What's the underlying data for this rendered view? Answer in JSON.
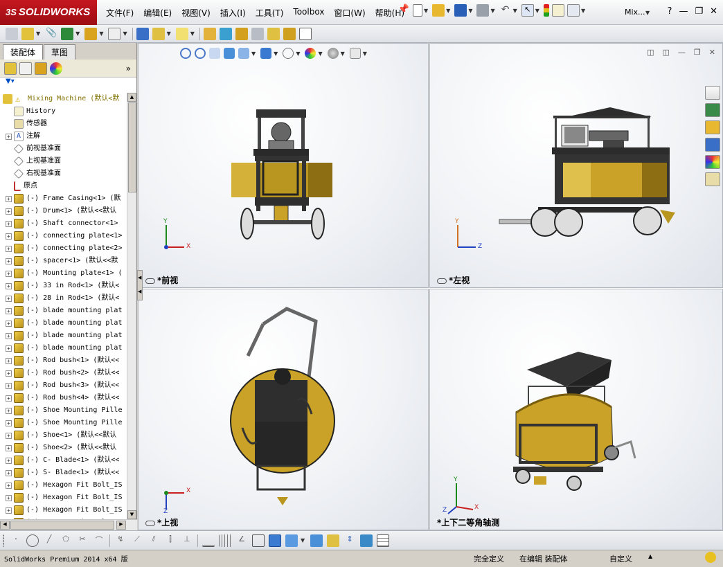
{
  "app": {
    "logo_ds": "3S",
    "logo_text": "SOLIDWORKS",
    "doc_short": "Mix..."
  },
  "menu": [
    "文件(F)",
    "编辑(E)",
    "视图(V)",
    "插入(I)",
    "工具(T)",
    "Toolbox",
    "窗口(W)",
    "帮助(H)"
  ],
  "window_controls": {
    "help": "?",
    "minimize": "—",
    "restore": "❐",
    "close": "✕"
  },
  "manager_tabs": [
    "装配体",
    "草图"
  ],
  "tree": {
    "root": "Mixing Machine  (默认<默",
    "items": [
      {
        "label": "History",
        "expandable": false
      },
      {
        "label": "传感器",
        "expandable": false
      },
      {
        "label": "注解",
        "expandable": true
      },
      {
        "label": "前视基准面",
        "expandable": false
      },
      {
        "label": "上视基准面",
        "expandable": false
      },
      {
        "label": "右视基准面",
        "expandable": false
      },
      {
        "label": "原点",
        "expandable": false
      },
      {
        "label": "(-) Frame Casing<1> (默",
        "expandable": true
      },
      {
        "label": "(-) Drum<1> (默认<<默认",
        "expandable": true
      },
      {
        "label": "(-) Shaft connector<1>",
        "expandable": true
      },
      {
        "label": "(-) connecting plate<1>",
        "expandable": true
      },
      {
        "label": "(-) connecting plate<2>",
        "expandable": true
      },
      {
        "label": "(-) spacer<1> (默认<<默",
        "expandable": true
      },
      {
        "label": "(-) Mounting plate<1> (",
        "expandable": true
      },
      {
        "label": "(-) 33 in Rod<1> (默认<",
        "expandable": true
      },
      {
        "label": "(-) 28 in Rod<1> (默认<",
        "expandable": true
      },
      {
        "label": "(-) blade mounting plat",
        "expandable": true
      },
      {
        "label": "(-) blade mounting plat",
        "expandable": true
      },
      {
        "label": "(-) blade mounting plat",
        "expandable": true
      },
      {
        "label": "(-) blade mounting plat",
        "expandable": true
      },
      {
        "label": "(-) Rod bush<1> (默认<<",
        "expandable": true
      },
      {
        "label": "(-) Rod bush<2> (默认<<",
        "expandable": true
      },
      {
        "label": "(-) Rod bush<3> (默认<<",
        "expandable": true
      },
      {
        "label": "(-) Rod bush<4> (默认<<",
        "expandable": true
      },
      {
        "label": "(-) Shoe Mounting Pille",
        "expandable": true
      },
      {
        "label": "(-) Shoe Mounting Pille",
        "expandable": true
      },
      {
        "label": "(-) Shoe<1> (默认<<默认",
        "expandable": true
      },
      {
        "label": "(-) Shoe<2> (默认<<默认",
        "expandable": true
      },
      {
        "label": "(-) C- Blade<1> (默认<<",
        "expandable": true
      },
      {
        "label": "(-) S- Blade<1> (默认<<",
        "expandable": true
      },
      {
        "label": "(-) Hexagon Fit Bolt_IS",
        "expandable": true
      },
      {
        "label": "(-) Hexagon Fit Bolt_IS",
        "expandable": true
      },
      {
        "label": "(-) Hexagon Fit Bolt_IS",
        "expandable": true
      },
      {
        "label": "(-) Hexagon Fit Bolt_IS",
        "expandable": true
      }
    ]
  },
  "viewports": [
    {
      "label": "*前视",
      "triad": [
        "Y",
        "X"
      ]
    },
    {
      "label": "*左视",
      "triad": [
        "Y",
        "Z"
      ]
    },
    {
      "label": "*上视",
      "triad": [
        "X",
        "Z"
      ]
    },
    {
      "label": "*上下二等角轴测",
      "triad": [
        "Y",
        "Z",
        "X"
      ]
    }
  ],
  "status": {
    "product": "SolidWorks Premium 2014 x64 版",
    "definition": "完全定义",
    "editing": "在编辑 装配体",
    "units": "自定义"
  },
  "colors": {
    "drum": "#c9a227",
    "frame": "#3a3a3a",
    "accent": "#c5171f"
  }
}
